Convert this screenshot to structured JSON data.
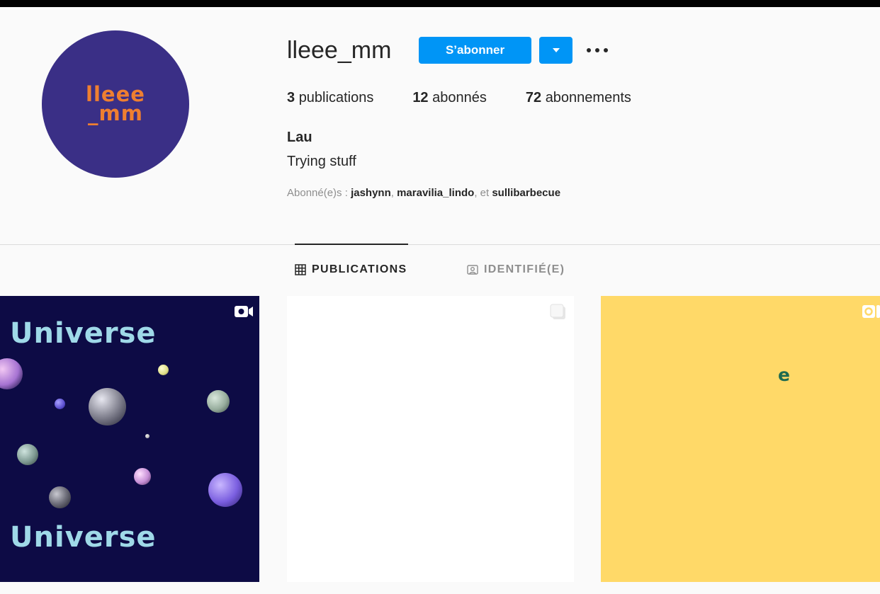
{
  "profile": {
    "avatar_line1": "lleee",
    "avatar_line2": "_mm",
    "username": "lleee_mm",
    "follow_label": "S’abonner",
    "stats": [
      {
        "count": "3",
        "label": "publications"
      },
      {
        "count": "12",
        "label": "abonnés"
      },
      {
        "count": "72",
        "label": "abonnements"
      }
    ],
    "full_name": "Lau",
    "bio": "Trying stuff",
    "followed_by": {
      "prefix": "Abonné(e)s : ",
      "users": [
        "jashynn",
        "maravilia_lindo",
        "sullibarbecue"
      ],
      "sep": ", ",
      "and": ", et "
    }
  },
  "tabs": [
    {
      "label": "PUBLICATIONS",
      "icon": "grid-icon",
      "active": true
    },
    {
      "label": "IDENTIFIÉ(E)",
      "icon": "tagged-person-icon",
      "active": false
    }
  ],
  "posts": [
    {
      "type": "video",
      "text_top": "Universe",
      "text_bottom": "Universe",
      "bg": "#0d0b45",
      "badge_icon": "video-camera-icon"
    },
    {
      "type": "carousel",
      "bg": "#ffffff",
      "badge_icon": "carousel-icon"
    },
    {
      "type": "igtv",
      "letter": "e",
      "bg": "#ffd968",
      "badge_icon": "igtv-icon"
    }
  ],
  "colors": {
    "accent": "#0095f6",
    "avatar_bg": "#3a2f86",
    "avatar_text": "#ef7f30",
    "muted": "#8e8e8e"
  }
}
